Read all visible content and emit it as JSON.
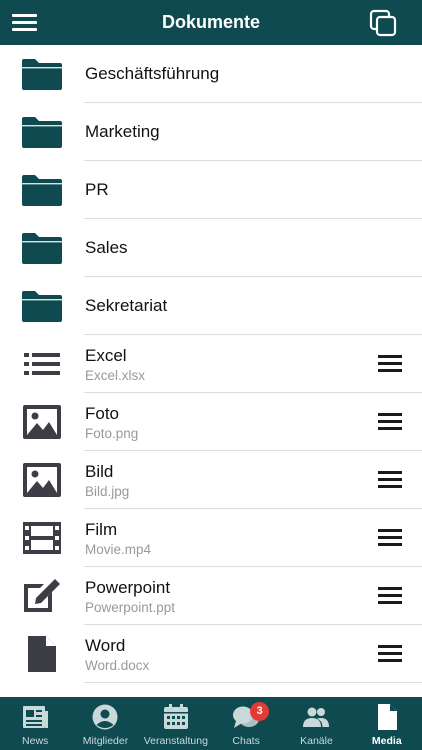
{
  "header": {
    "title": "Dokumente"
  },
  "folders": [
    {
      "name": "Geschäftsführung"
    },
    {
      "name": "Marketing"
    },
    {
      "name": "PR"
    },
    {
      "name": "Sales"
    },
    {
      "name": "Sekretariat"
    }
  ],
  "files": [
    {
      "name": "Excel",
      "filename": "Excel.xlsx",
      "icon": "list-icon"
    },
    {
      "name": "Foto",
      "filename": "Foto.png",
      "icon": "image-icon"
    },
    {
      "name": "Bild",
      "filename": "Bild.jpg",
      "icon": "image-icon"
    },
    {
      "name": "Film",
      "filename": "Movie.mp4",
      "icon": "film-icon"
    },
    {
      "name": "Powerpoint",
      "filename": "Powerpoint.ppt",
      "icon": "edit-icon"
    },
    {
      "name": "Word",
      "filename": "Word.docx",
      "icon": "document-icon"
    }
  ],
  "tabs": [
    {
      "label": "News",
      "icon": "newspaper-icon"
    },
    {
      "label": "Mitglieder",
      "icon": "account-circle-icon"
    },
    {
      "label": "Veranstaltung",
      "icon": "calendar-icon"
    },
    {
      "label": "Chats",
      "icon": "chat-bubbles-icon",
      "badge": "3"
    },
    {
      "label": "Kanäle",
      "icon": "people-icon"
    },
    {
      "label": "Media",
      "icon": "file-icon",
      "active": true
    }
  ],
  "colors": {
    "brand": "#0e4a4f",
    "badge": "#e53935",
    "icon_dark": "#3d3d45"
  }
}
